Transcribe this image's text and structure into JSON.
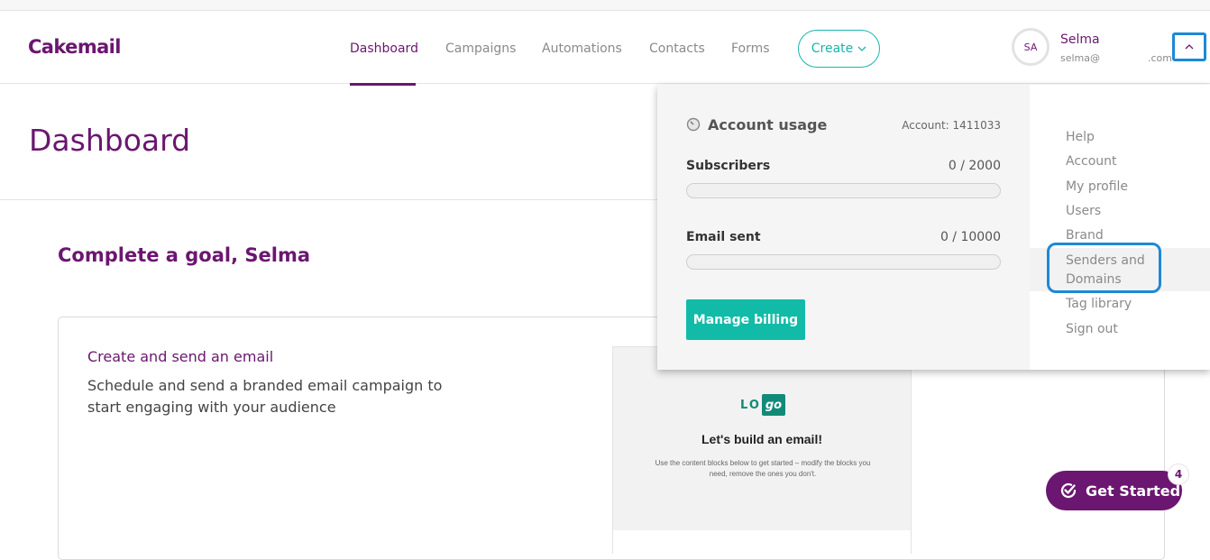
{
  "nav": {
    "logo": "Cakemail",
    "links": [
      {
        "label": "Dashboard",
        "active": true
      },
      {
        "label": "Campaigns"
      },
      {
        "label": "Automations"
      },
      {
        "label": "Contacts"
      },
      {
        "label": "Forms"
      }
    ],
    "create_label": "Create",
    "user": {
      "initials": "SA",
      "name": "Selma",
      "email_start": "selma@",
      "email_end": ".com"
    }
  },
  "page": {
    "title": "Dashboard",
    "goal_heading": "Complete a goal, Selma",
    "goal_card": {
      "title": "Create and send an email",
      "description": "Schedule and send a branded email campaign to start engaging with your audience"
    },
    "preview": {
      "logo_left": "LO",
      "logo_right": "go",
      "headline": "Let's build an email!",
      "body": "Use the content blocks below to get started – modify the blocks you need, remove the ones you don't."
    }
  },
  "account_menu": {
    "usage": {
      "title": "Account usage",
      "account": "Account: 1411033",
      "metrics": [
        {
          "label": "Subscribers",
          "value": "0 / 2000",
          "used": 0,
          "limit": 2000
        },
        {
          "label": "Email sent",
          "value": "0 / 10000",
          "used": 0,
          "limit": 10000
        }
      ],
      "billing_button": "Manage billing"
    },
    "items": [
      "Help",
      "Account",
      "My profile",
      "Users",
      "Brand",
      "Senders and Domains",
      "Tag library",
      "Sign out"
    ]
  },
  "get_started": {
    "label": "Get Started",
    "badge": "4"
  },
  "colors": {
    "brand": "#6b1670",
    "accent": "#19b5ac",
    "highlight": "#1e88d6"
  }
}
